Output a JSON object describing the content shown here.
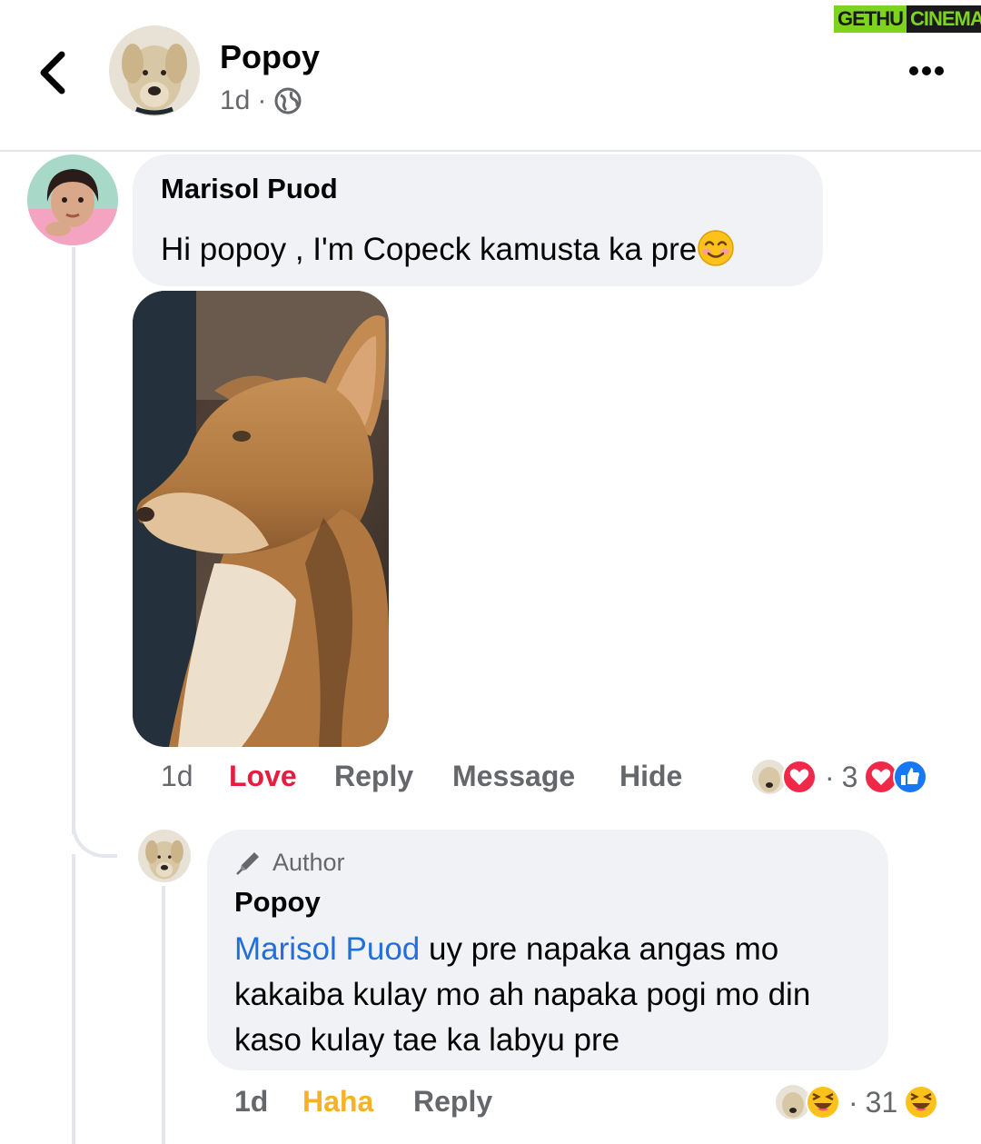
{
  "watermark": {
    "left": "GETHU",
    "right": "CINEMA"
  },
  "header": {
    "name": "Popoy",
    "time": "1d",
    "separator": "·"
  },
  "comment": {
    "author": "Marisol Puod",
    "text": "Hi popoy , I'm Copeck kamusta ka pre",
    "emoji": "smiling-face-emoji",
    "actions": {
      "time": "1d",
      "love": "Love",
      "reply": "Reply",
      "message": "Message",
      "hide": "Hide"
    },
    "reactions": {
      "dot": "·",
      "count": "3"
    }
  },
  "reply": {
    "badge": "Author",
    "author": "Popoy",
    "mention": "Marisol Puod",
    "text": " uy pre napaka angas mo kakaiba kulay mo ah napaka pogi mo din kaso kulay tae ka labyu pre",
    "actions": {
      "time": "1d",
      "haha": "Haha",
      "reply": "Reply"
    },
    "reactions": {
      "dot": "·",
      "count": "31"
    }
  },
  "colors": {
    "love": "#e41e3f",
    "haha": "#f7b125",
    "mention": "#216fdb",
    "bubble": "#f0f2f5",
    "meta": "#65676b"
  }
}
